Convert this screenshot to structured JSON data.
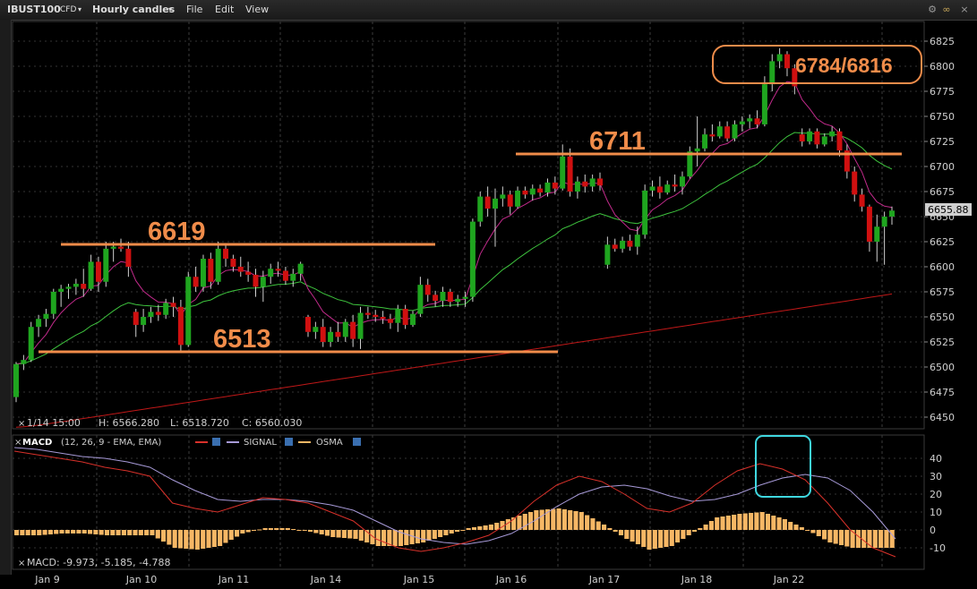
{
  "toolbar": {
    "symbol": "IBUST100",
    "symbol_type": "CFD",
    "timeframe": "Hourly candles",
    "menu_file": "File",
    "menu_edit": "Edit",
    "menu_view": "View"
  },
  "price_panel": {
    "ohlc_date": "1/14 15:00",
    "ohlc_high": "H: 6566.280",
    "ohlc_low": "L: 6518.720",
    "ohlc_close": "C: 6560.030",
    "last_price": "6655.88",
    "annotations": {
      "resistance_1": "6619",
      "support_1": "6513",
      "resistance_2": "6711",
      "range_box": "6784/6816"
    }
  },
  "macd_panel": {
    "title": "MACD",
    "params": "(12, 26, 9 - EMA, EMA)",
    "signal_label": "SIGNAL",
    "osma_label": "OSMA",
    "values": "MACD: -9.973, -5.185, -4.788"
  },
  "colors": {
    "up_candle": "#1fa51f",
    "down_candle": "#d01010",
    "ema_fast": "#c02a8a",
    "ema_mid": "#3ec43e",
    "ema_slow": "#c01818",
    "macd_line": "#d8312a",
    "signal_line": "#a79ad8",
    "osma": "#f6b765",
    "annotation": "#f08c4a",
    "highlight_box": "#3fd8e0"
  },
  "chart_data": [
    {
      "type": "candlestick",
      "title": "IBUST100 CFD Hourly candles",
      "x_labels": [
        "Jan 9",
        "Jan 10",
        "Jan 11",
        "Jan 14",
        "Jan 15",
        "Jan 16",
        "Jan 17",
        "Jan 18",
        "Jan 22"
      ],
      "ylim": [
        6440,
        6830
      ],
      "y_ticks": [
        6450,
        6475,
        6500,
        6525,
        6550,
        6575,
        6600,
        6625,
        6650,
        6675,
        6700,
        6725,
        6750,
        6775,
        6800,
        6825
      ],
      "grid": true,
      "levels": [
        {
          "label": "6619",
          "value": 6619
        },
        {
          "label": "6513",
          "value": 6511
        },
        {
          "label": "6711",
          "value": 6711
        }
      ],
      "range_box": {
        "label": "6784/6816",
        "low": 6784,
        "high": 6816
      },
      "last_price": 6655.88,
      "candles": [
        [
          6470,
          6505,
          6465,
          6503
        ],
        [
          6503,
          6512,
          6497,
          6507
        ],
        [
          6507,
          6545,
          6505,
          6540
        ],
        [
          6540,
          6552,
          6530,
          6548
        ],
        [
          6548,
          6558,
          6540,
          6553
        ],
        [
          6553,
          6578,
          6548,
          6575
        ],
        [
          6575,
          6582,
          6560,
          6578
        ],
        [
          6578,
          6583,
          6568,
          6580
        ],
        [
          6580,
          6588,
          6572,
          6583
        ],
        [
          6583,
          6598,
          6570,
          6578
        ],
        [
          6578,
          6612,
          6576,
          6605
        ],
        [
          6605,
          6610,
          6575,
          6585
        ],
        [
          6585,
          6625,
          6580,
          6618
        ],
        [
          6618,
          6625,
          6605,
          6620
        ],
        [
          6620,
          6628,
          6615,
          6618
        ],
        [
          6618,
          6625,
          6590,
          6600
        ],
        [
          6555,
          6558,
          6530,
          6542
        ],
        [
          6542,
          6558,
          6535,
          6550
        ],
        [
          6550,
          6560,
          6544,
          6555
        ],
        [
          6555,
          6562,
          6546,
          6552
        ],
        [
          6552,
          6568,
          6548,
          6564
        ],
        [
          6564,
          6570,
          6550,
          6560
        ],
        [
          6560,
          6567,
          6515,
          6522
        ],
        [
          6522,
          6595,
          6520,
          6590
        ],
        [
          6590,
          6600,
          6575,
          6580
        ],
        [
          6580,
          6612,
          6575,
          6608
        ],
        [
          6608,
          6614,
          6578,
          6585
        ],
        [
          6585,
          6625,
          6582,
          6618
        ],
        [
          6618,
          6622,
          6600,
          6608
        ],
        [
          6608,
          6612,
          6595,
          6600
        ],
        [
          6600,
          6610,
          6590,
          6595
        ],
        [
          6595,
          6605,
          6585,
          6592
        ],
        [
          6592,
          6598,
          6570,
          6580
        ],
        [
          6580,
          6596,
          6565,
          6590
        ],
        [
          6590,
          6603,
          6583,
          6598
        ],
        [
          6598,
          6605,
          6590,
          6596
        ],
        [
          6596,
          6600,
          6582,
          6586
        ],
        [
          6586,
          6598,
          6580,
          6593
        ],
        [
          6593,
          6605,
          6586,
          6603
        ],
        [
          6550,
          6552,
          6530,
          6535
        ],
        [
          6535,
          6545,
          6528,
          6540
        ],
        [
          6540,
          6548,
          6520,
          6525
        ],
        [
          6525,
          6540,
          6520,
          6535
        ],
        [
          6535,
          6545,
          6525,
          6530
        ],
        [
          6530,
          6548,
          6525,
          6545
        ],
        [
          6545,
          6552,
          6520,
          6528
        ],
        [
          6528,
          6560,
          6518,
          6554
        ],
        [
          6554,
          6560,
          6548,
          6552
        ],
        [
          6552,
          6557,
          6545,
          6550
        ],
        [
          6550,
          6556,
          6543,
          6548
        ],
        [
          6548,
          6553,
          6538,
          6544
        ],
        [
          6544,
          6562,
          6535,
          6558
        ],
        [
          6558,
          6562,
          6538,
          6542
        ],
        [
          6542,
          6556,
          6540,
          6553
        ],
        [
          6553,
          6590,
          6550,
          6582
        ],
        [
          6582,
          6588,
          6565,
          6572
        ],
        [
          6572,
          6576,
          6560,
          6566
        ],
        [
          6566,
          6580,
          6560,
          6575
        ],
        [
          6575,
          6578,
          6560,
          6565
        ],
        [
          6565,
          6572,
          6560,
          6568
        ],
        [
          6568,
          6575,
          6560,
          6570
        ],
        [
          6570,
          6648,
          6565,
          6645
        ],
        [
          6645,
          6675,
          6640,
          6670
        ],
        [
          6670,
          6680,
          6650,
          6658
        ],
        [
          6658,
          6678,
          6620,
          6668
        ],
        [
          6668,
          6680,
          6660,
          6672
        ],
        [
          6672,
          6676,
          6652,
          6660
        ],
        [
          6660,
          6680,
          6658,
          6676
        ],
        [
          6676,
          6680,
          6668,
          6672
        ],
        [
          6672,
          6682,
          6666,
          6678
        ],
        [
          6678,
          6682,
          6670,
          6674
        ],
        [
          6674,
          6688,
          6670,
          6684
        ],
        [
          6684,
          6690,
          6672,
          6678
        ],
        [
          6678,
          6722,
          6676,
          6710
        ],
        [
          6710,
          6718,
          6670,
          6675
        ],
        [
          6675,
          6690,
          6668,
          6685
        ],
        [
          6685,
          6692,
          6674,
          6680
        ],
        [
          6680,
          6692,
          6675,
          6688
        ],
        [
          6688,
          6694,
          6676,
          6681
        ],
        [
          6602,
          6630,
          6598,
          6622
        ],
        [
          6622,
          6628,
          6615,
          6618
        ],
        [
          6618,
          6630,
          6614,
          6626
        ],
        [
          6626,
          6632,
          6616,
          6620
        ],
        [
          6620,
          6640,
          6612,
          6632
        ],
        [
          6632,
          6682,
          6628,
          6676
        ],
        [
          6676,
          6686,
          6670,
          6680
        ],
        [
          6680,
          6690,
          6668,
          6674
        ],
        [
          6674,
          6686,
          6672,
          6682
        ],
        [
          6682,
          6692,
          6675,
          6680
        ],
        [
          6680,
          6695,
          6672,
          6690
        ],
        [
          6690,
          6720,
          6688,
          6715
        ],
        [
          6715,
          6750,
          6700,
          6718
        ],
        [
          6718,
          6738,
          6715,
          6732
        ],
        [
          6732,
          6742,
          6725,
          6730
        ],
        [
          6730,
          6745,
          6728,
          6740
        ],
        [
          6740,
          6745,
          6725,
          6728
        ],
        [
          6728,
          6746,
          6725,
          6742
        ],
        [
          6742,
          6750,
          6735,
          6745
        ],
        [
          6745,
          6752,
          6738,
          6748
        ],
        [
          6748,
          6756,
          6738,
          6742
        ],
        [
          6742,
          6790,
          6740,
          6782
        ],
        [
          6782,
          6812,
          6775,
          6805
        ],
        [
          6805,
          6818,
          6798,
          6812
        ],
        [
          6812,
          6815,
          6790,
          6798
        ],
        [
          6798,
          6802,
          6772,
          6780
        ],
        [
          6732,
          6738,
          6720,
          6725
        ],
        [
          6725,
          6738,
          6722,
          6735
        ],
        [
          6735,
          6738,
          6718,
          6722
        ],
        [
          6722,
          6733,
          6720,
          6730
        ],
        [
          6730,
          6740,
          6725,
          6735
        ],
        [
          6735,
          6738,
          6710,
          6716
        ],
        [
          6716,
          6722,
          6688,
          6695
        ],
        [
          6695,
          6700,
          6665,
          6672
        ],
        [
          6672,
          6678,
          6655,
          6660
        ],
        [
          6660,
          6662,
          6615,
          6625
        ],
        [
          6625,
          6652,
          6605,
          6640
        ],
        [
          6640,
          6655,
          6602,
          6650
        ],
        [
          6650,
          6660,
          6642,
          6656
        ]
      ]
    },
    {
      "type": "bar+line",
      "title": "MACD",
      "ylim": [
        -17,
        50
      ],
      "y_ticks": [
        -10,
        0,
        10,
        20,
        30,
        40
      ],
      "x_labels": [
        "Jan 9",
        "Jan 10",
        "Jan 11",
        "Jan 14",
        "Jan 15",
        "Jan 16",
        "Jan 17",
        "Jan 18",
        "Jan 22"
      ],
      "series": [
        {
          "name": "MACD",
          "values": [
            44,
            42,
            40,
            38,
            35,
            33,
            30,
            15,
            12,
            10,
            14,
            18,
            17,
            15,
            10,
            5,
            -5,
            -10,
            -12,
            -10,
            -7,
            -3,
            5,
            16,
            25,
            30,
            27,
            20,
            12,
            10,
            15,
            25,
            33,
            37,
            34,
            28,
            15,
            0,
            -10,
            -15
          ]
        },
        {
          "name": "SIGNAL",
          "values": [
            46,
            45,
            43,
            41,
            40,
            38,
            35,
            28,
            22,
            17,
            16,
            17,
            17,
            16,
            14,
            11,
            5,
            -1,
            -5,
            -7,
            -8,
            -6,
            -2,
            5,
            13,
            20,
            24,
            25,
            23,
            19,
            16,
            17,
            20,
            25,
            29,
            31,
            29,
            22,
            10,
            -5
          ]
        },
        {
          "name": "OSMA",
          "values": [
            -3,
            -3,
            -2,
            -2,
            -3,
            -3,
            -3,
            -10,
            -11,
            -9,
            -2,
            1,
            1,
            -1,
            -4,
            -5,
            -9,
            -9,
            -7,
            -3,
            1,
            3,
            7,
            11,
            12,
            10,
            3,
            -5,
            -11,
            -9,
            -1,
            7,
            9,
            10,
            6,
            0,
            -7,
            -10,
            -10,
            -10
          ]
        }
      ]
    }
  ]
}
